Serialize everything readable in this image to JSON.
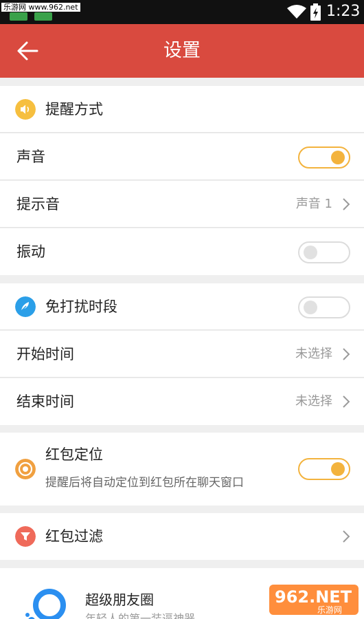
{
  "status_bar": {
    "watermark": "乐游网 www.962.net",
    "time": "1:23"
  },
  "app_bar": {
    "title": "设置"
  },
  "sections": {
    "reminder": {
      "header_label": "提醒方式",
      "sound_label": "声音",
      "tone_label": "提示音",
      "tone_value": "声音 1",
      "vibrate_label": "振动"
    },
    "dnd": {
      "header_label": "免打扰时段",
      "start_label": "开始时间",
      "start_value": "未选择",
      "end_label": "结束时间",
      "end_value": "未选择"
    },
    "locate": {
      "label": "红包定位",
      "description": "提醒后将自动定位到红包所在聊天窗口"
    },
    "filter": {
      "label": "红包过滤"
    }
  },
  "promo": {
    "title": "超级朋友圈",
    "subtitle": "年轻人的第一装逼神器"
  },
  "toggles": {
    "sound": true,
    "vibrate": false,
    "dnd": false,
    "locate": true
  },
  "colors": {
    "accent_red": "#d94a3f",
    "toggle_on": "#f3b33d",
    "icon_blue": "#2b9fe8",
    "icon_orange": "#f0a040",
    "icon_red": "#ef6a5a"
  },
  "icons": [
    "back-arrow-icon",
    "speaker-icon",
    "feather-icon",
    "target-icon",
    "funnel-icon",
    "chevron-right-icon",
    "wifi-icon",
    "battery-charging-icon"
  ]
}
